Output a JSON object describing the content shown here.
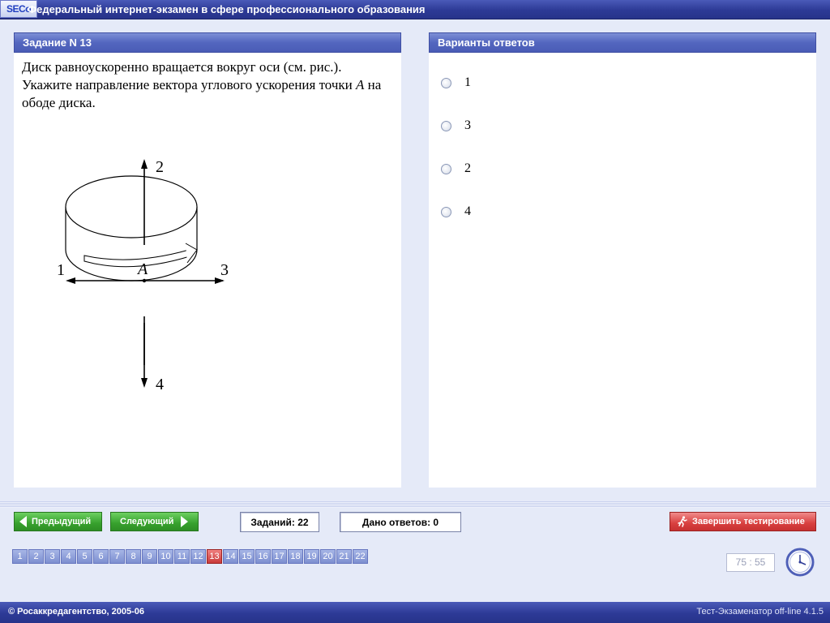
{
  "app": {
    "logo": "SECo",
    "title": "Федеральный интернет-экзамен в сфере профессионального образования"
  },
  "question": {
    "header": "Задание N 13",
    "text": "Диск равноускоренно вращается вокруг оси (см. рис.). Укажите направление вектора углового ускорения точки A на ободе диска.",
    "text_before_point": "Диск равноускоренно вращается вокруг оси (см. рис.). Укажите направление вектора углового ускорения точки ",
    "point": "A",
    "text_after_point": " на ободе диска.",
    "figure": {
      "labels": {
        "up": "2",
        "left": "1",
        "right": "3",
        "down": "4",
        "point": "A"
      }
    }
  },
  "answers": {
    "header": "Варианты ответов",
    "options": [
      {
        "label": "1",
        "selected": false
      },
      {
        "label": "3",
        "selected": false
      },
      {
        "label": "2",
        "selected": false
      },
      {
        "label": "4",
        "selected": false
      }
    ]
  },
  "navigation": {
    "prev_label": "Предыдущий",
    "next_label": "Следующий",
    "tasks_count": "Заданий: 22",
    "answered_count": "Дано ответов: 0",
    "finish_label": "Завершить тестирование",
    "question_numbers": [
      "1",
      "2",
      "3",
      "4",
      "5",
      "6",
      "7",
      "8",
      "9",
      "10",
      "11",
      "12",
      "13",
      "14",
      "15",
      "16",
      "17",
      "18",
      "19",
      "20",
      "21",
      "22"
    ],
    "current_question": "13"
  },
  "timer": {
    "value": "75 : 55"
  },
  "footer": {
    "copyright": "© Росаккредагентство, 2005-06",
    "version": "Тест-Экзаменатор off-line 4.1.5"
  },
  "colors": {
    "title_bar": "#2d3a96",
    "panel_header": "#5366bf",
    "background": "#e5eaf8",
    "nav_green": "#37a12d",
    "finish_red": "#d9403f",
    "active_question": "#c93a3a"
  },
  "icons": {
    "finish": "runner-icon",
    "timer": "clock-icon",
    "prev": "arrow-left-icon",
    "next": "arrow-right-icon"
  }
}
